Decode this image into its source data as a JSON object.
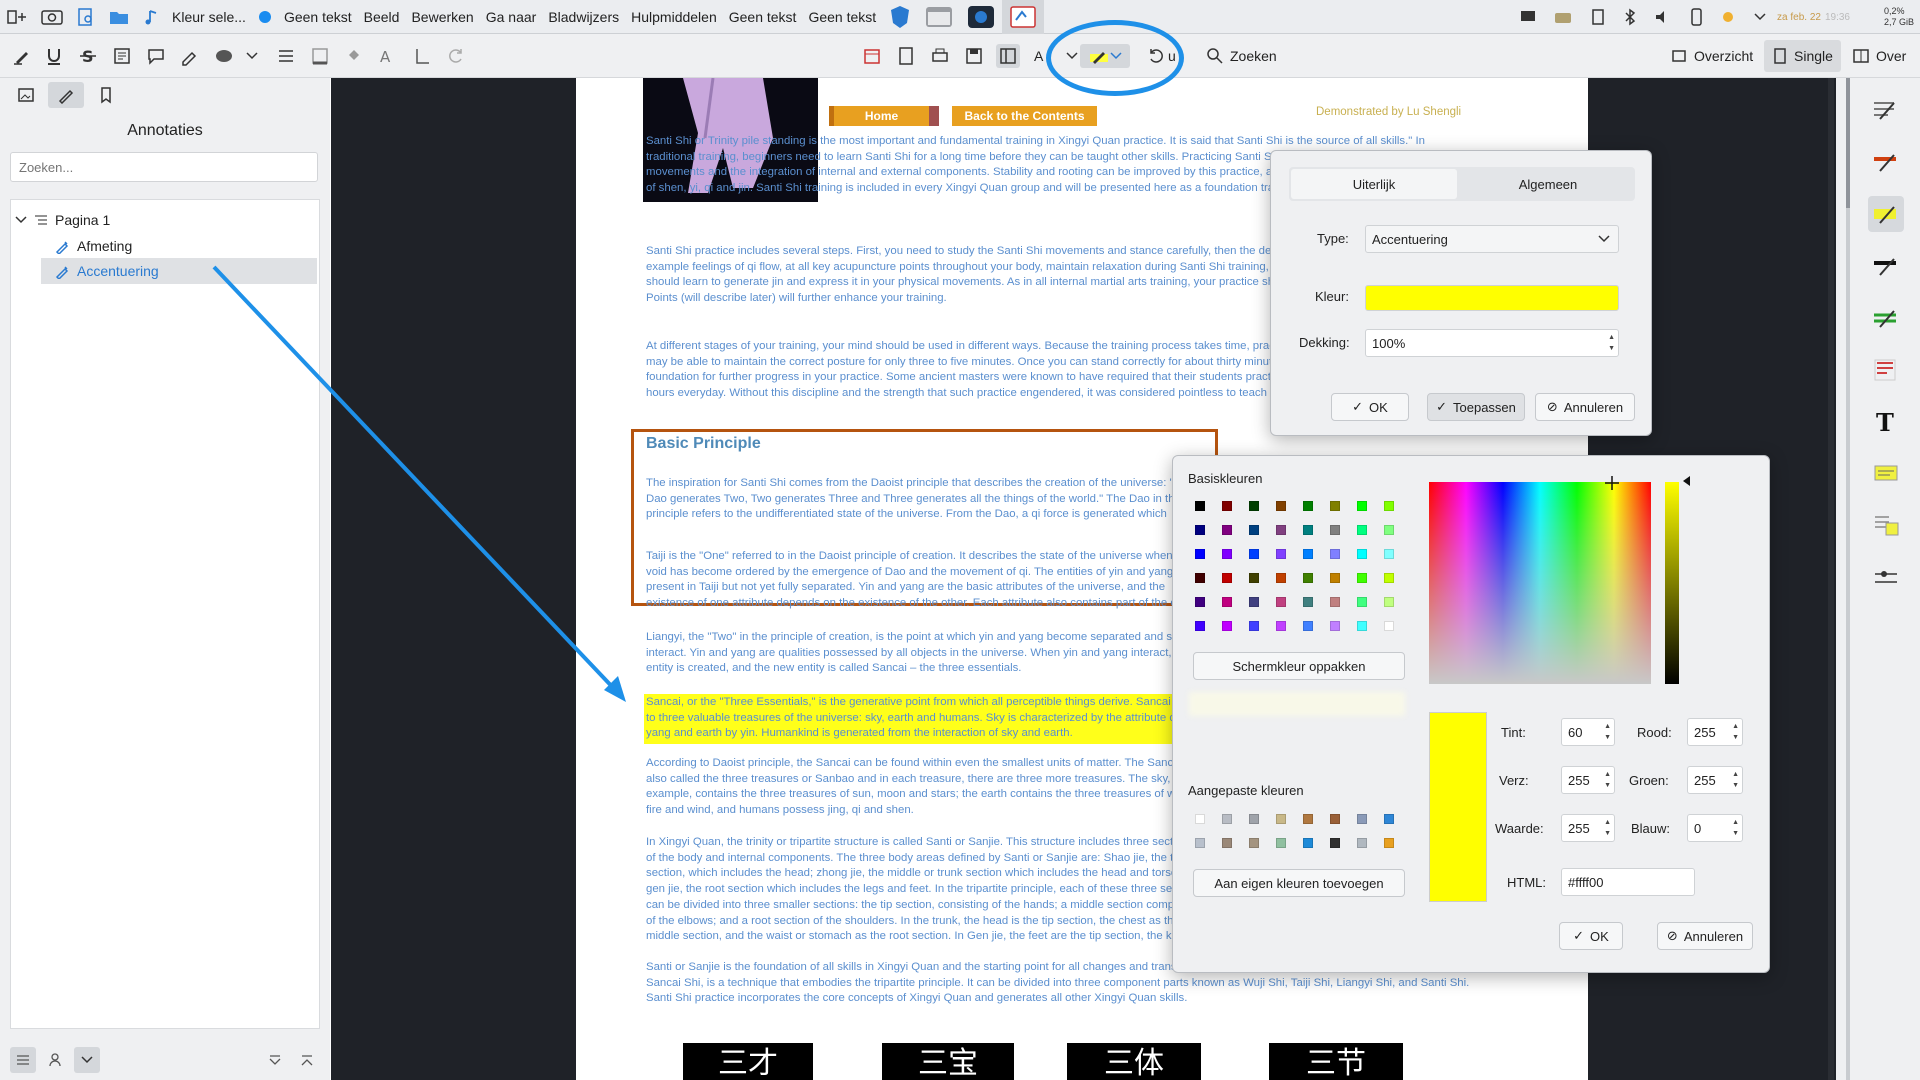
{
  "panel": {
    "window_title": "Kleur sele...",
    "menu": [
      "Geen tekst",
      "Beeld",
      "Bewerken",
      "Ga naar",
      "Bladwijzers",
      "Hulpmiddelen",
      "Geen tekst",
      "Geen tekst"
    ],
    "clock_date": "za feb. 22",
    "clock_time": "19:36",
    "cpu": "0,2%",
    "mem": "2,7 GiB"
  },
  "toolbar": {
    "search_label": "Zoeken",
    "overview_label": "Overzicht",
    "single_label": "Single",
    "over_label": "Over",
    "partial_letter": "A",
    "partial_undo": "u"
  },
  "sidebar": {
    "title": "Annotaties",
    "search_placeholder": "Zoeken...",
    "tree": {
      "page": "Pagina 1",
      "items": [
        "Afmeting",
        "Accentuering"
      ]
    }
  },
  "document": {
    "nav": {
      "home": "Home",
      "back": "Back to the Contents",
      "credit": "Demonstrated by Lu Shengli"
    },
    "paragraphs": [
      "Santi Shi or Trinity pile standing is the most important and fundamental training in Xingyi Quan practice. It is said that Santi Shi is the source of all skills.\" In traditional training, beginners need to learn Santi Shi for a long time before they can be taught other skills. Practicing Santi Shi can help practitioners coordinate movements and the integration of internal and external components. Stability and rooting can be improved by this practice, as can relaxation and the control and use of shen, yi, qi and jin. Santi Shi training is included in every Xingyi Quan group and will be presented here as a foundation training for martial arts fighting skills.",
      "Santi Shi practice includes several steps. First, you need to study the Santi Shi movements and stance carefully, then the development of correct feelings, for example feelings of qi flow, at all key acupuncture points throughout your body, maintain relaxation during Santi Shi training, especially for beginners. Secondly, you should learn to generate jin and express it in your physical movements. As in all internal martial arts training, your practice should be led by your yi. The Four Key Points (will describe later) will further enhance your training.",
      "At different stages of your training, your mind should be used in different ways. Because the training process takes time, practice daily and have patience. Beginners may be able to maintain the correct posture for only three to five minutes. Once you can stand correctly for about thirty minutes, you will have developed a strong foundation for further progress in your practice. Some ancient masters were known to have required that their students practice Santi Shi for at least one to two hours everyday. Without this discipline and the strength that such practice engendered, it was considered pointless to teach other skills."
    ],
    "heading": "Basic Principle",
    "paragraphs2": [
      "The inspiration for Santi Shi comes from the Daoist principle that describes the creation of the universe: \"The Dao generates Two, Two generates Three and Three generates all the things of the world.\" The Dao in this principle refers to the undifferentiated state of the universe. From the Dao, a qi force is generated which initiates changes from the wuji state to the yin and yang. Thus, although the xuwu state appeared to be empty, it had within it a creative force that gives rise to all things.",
      "Taiji is the \"One\" referred to in the Daoist principle of creation. It describes the state of the universe when the void has become ordered by the emergence of Dao and the movement of qi. The entities of yin and yang are present in Taiji but not yet fully separated. Yin and yang are the basic attributes of the universe, and the existence of one attribute depends on the existence of the other. Each attribute also contains part of the other within it.",
      "Liangyi, the \"Two\" in the principle of creation, is the point at which yin and yang become separated and start to interact. Yin and yang are qualities possessed by all objects in the universe. When yin and yang interact, a new entity is created, and the new entity is called Sancai – the three essentials.",
      "Sancai, or the \"Three Essentials,\" is the generative point from which all perceptible things derive. Sancai refers to three valuable treasures of the universe: sky, earth and humans. Sky is characterized by the attribute of yang and earth by yin. Humankind is generated from the interaction of sky and earth.",
      "According to Daoist principle, the Sancai can be found within even the smallest units of matter. The Sancai is also called the three treasures or Sanbao and in each treasure, there are three more treasures. The sky, for example, contains the three treasures of sun, moon and stars; the earth contains the three treasures of water, fire and wind, and humans possess jing, qi and shen.",
      "In Xingyi Quan, the trinity or tripartite structure is called Santi or Sanjie. This structure includes three sections of the body and internal components. The three body areas defined by Santi or Sanjie are: Shao jie, the tip section, which includes the head; zhong jie, the middle or trunk section which includes the head and torso; and gen jie, the root section which includes the legs and feet. In the tripartite principle, each of these three sections can be divided into three smaller sections: the tip section, consisting of the hands; a middle section comprised of the elbows; and a root section of the shoulders. In the trunk, the head is the tip section, the chest as the middle section, and the waist or stomach as the root section. In Gen jie, the feet are the tip section, the knees the middle section, and the hips are the root section. The three internal components of Santi or Sanjie are jing, qi and shen.",
      "Santi or Sanjie is the foundation of all skills in Xingyi Quan and the starting point for all changes and transformations in Xingyi Quan. Santi Shi, also commonly called Sancai Shi, is a technique that embodies the tripartite principle. It can be divided into three component parts known as Wuji Shi, Taiji Shi, Liangyi Shi, and Santi Shi. Santi Shi practice incorporates the core concepts of Xingyi Quan and generates all other Xingyi Quan skills."
    ],
    "glyphs": [
      "三才",
      "三宝",
      "三体",
      "三节"
    ]
  },
  "annot_dialog": {
    "tabs": [
      "Uiterlijk",
      "Algemeen"
    ],
    "type_label": "Type:",
    "type_value": "Accentuering",
    "color_label": "Kleur:",
    "color_value": "#ffff00",
    "opacity_label": "Dekking:",
    "opacity_value": "100%",
    "ok": "OK",
    "apply": "Toepassen",
    "cancel": "Annuleren"
  },
  "color_dialog": {
    "basic_label": "Basiskleuren",
    "pick_screen": "Schermkleur oppakken",
    "custom_label": "Aangepaste kleuren",
    "add_custom": "Aan eigen kleuren toevoegen",
    "hue_label": "Tint:",
    "hue": "60",
    "sat_label": "Verz:",
    "sat": "255",
    "val_label": "Waarde:",
    "val": "255",
    "red_label": "Rood:",
    "red": "255",
    "green_label": "Groen:",
    "green": "255",
    "blue_label": "Blauw:",
    "blue": "0",
    "html_label": "HTML:",
    "html": "#ffff00",
    "ok": "OK",
    "cancel": "Annuleren",
    "basic_colors": [
      "#000000",
      "#800000",
      "#004000",
      "#804000",
      "#008000",
      "#808000",
      "#00ff00",
      "#80ff00",
      "#000080",
      "#800080",
      "#004080",
      "#804080",
      "#008080",
      "#808080",
      "#00ff80",
      "#80ff80",
      "#0000ff",
      "#8000ff",
      "#0040ff",
      "#8040ff",
      "#0080ff",
      "#8080ff",
      "#00ffff",
      "#80ffff",
      "#400000",
      "#c00000",
      "#404000",
      "#c04000",
      "#408000",
      "#c08000",
      "#40ff00",
      "#c0ff00",
      "#400080",
      "#c00080",
      "#404080",
      "#c04080",
      "#408080",
      "#c08080",
      "#40ff80",
      "#c0ff80",
      "#4000ff",
      "#c000ff",
      "#4040ff",
      "#c040ff",
      "#4080ff",
      "#c080ff",
      "#40ffff",
      "#ffffff"
    ],
    "custom_colors": [
      "#ffffff",
      "#b8bcc4",
      "#9fa3aa",
      "#c8b888",
      "#b07840",
      "#9a6038",
      "#8a9ab8",
      "#2e86d6",
      "#b8c0cc",
      "#9a8878",
      "#a49480",
      "#90c0a0",
      "#1e8ad8",
      "#303030",
      "#b0b8c0",
      "#e8a020"
    ]
  }
}
